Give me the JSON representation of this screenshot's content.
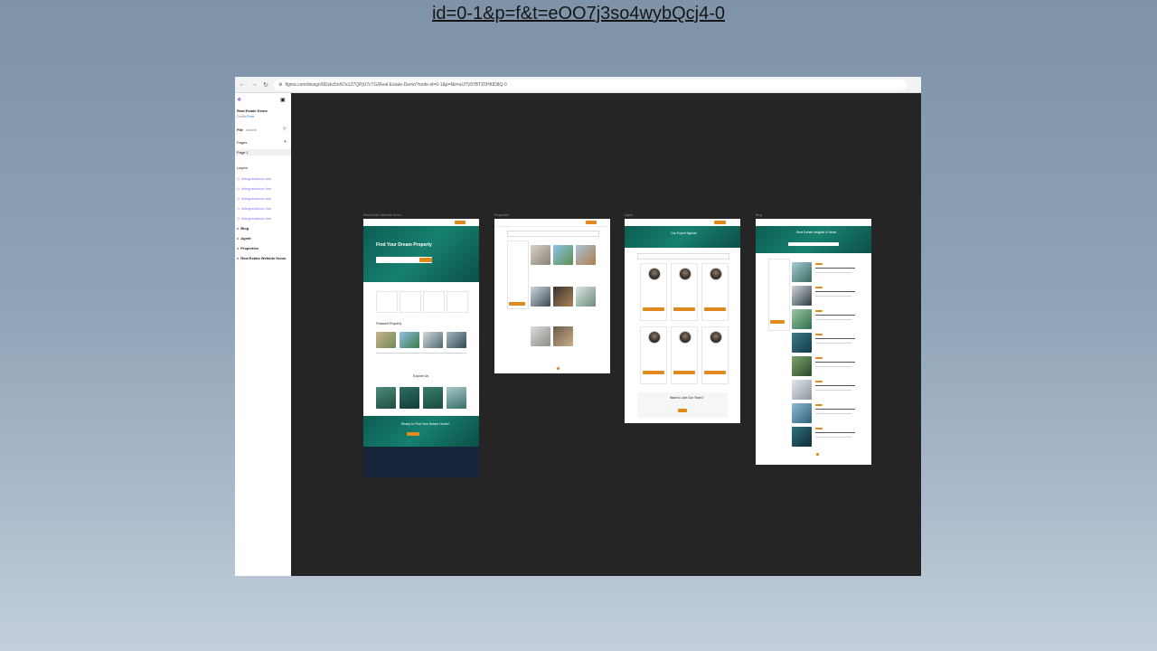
{
  "overlay": {
    "url_text": "id=0-1&p=f&t=eOO7j3so4wybQcj4-0"
  },
  "browser": {
    "address": "figma.com/design/9Dzkc5nN7e1Z7QPjU7cTG/Real-Estate-Demo?node-id=0-1&p=f&t=uU7V97BTZ0HKlD8Q-0"
  },
  "sidebar": {
    "file_name": "Real Estate Demo",
    "file_sub": "Drafts",
    "file_plan": "Free",
    "tab_file": "File",
    "tab_assets": "Assets",
    "pages_heading": "Pages",
    "page_1": "Page 1",
    "layers_heading": "Layers",
    "layers": [
      {
        "label": "inlinguscdecor-line",
        "kind": "component"
      },
      {
        "label": "inlinguscdecor-line",
        "kind": "component"
      },
      {
        "label": "inlinguscdecor-line",
        "kind": "component"
      },
      {
        "label": "inlinguscdecor-line",
        "kind": "component"
      },
      {
        "label": "inlinguscdecor-line",
        "kind": "component"
      },
      {
        "label": "Blog",
        "kind": "frame"
      },
      {
        "label": "Agent",
        "kind": "frame"
      },
      {
        "label": "Properties",
        "kind": "frame"
      },
      {
        "label": "Real Estate Website Demo",
        "kind": "frame"
      }
    ]
  },
  "frames": [
    {
      "label": "Real Estate Website Demo",
      "hero_title": "Find Your Dream Property",
      "section_featured": "Featured Property",
      "section_explore": "Explore Us",
      "cta_title": "Ready to Find Your Dream Home?"
    },
    {
      "label": "Properties"
    },
    {
      "label": "Agent",
      "hero_title": "Our Expert Agents",
      "cta_title": "Want to Join Our Team?"
    },
    {
      "label": "Blog",
      "hero_title": "Real Estate Insights & News"
    }
  ],
  "colors": {
    "accent": "#e08a1e",
    "teal": "#12705f",
    "canvas": "#252525",
    "footer": "#16253a"
  }
}
